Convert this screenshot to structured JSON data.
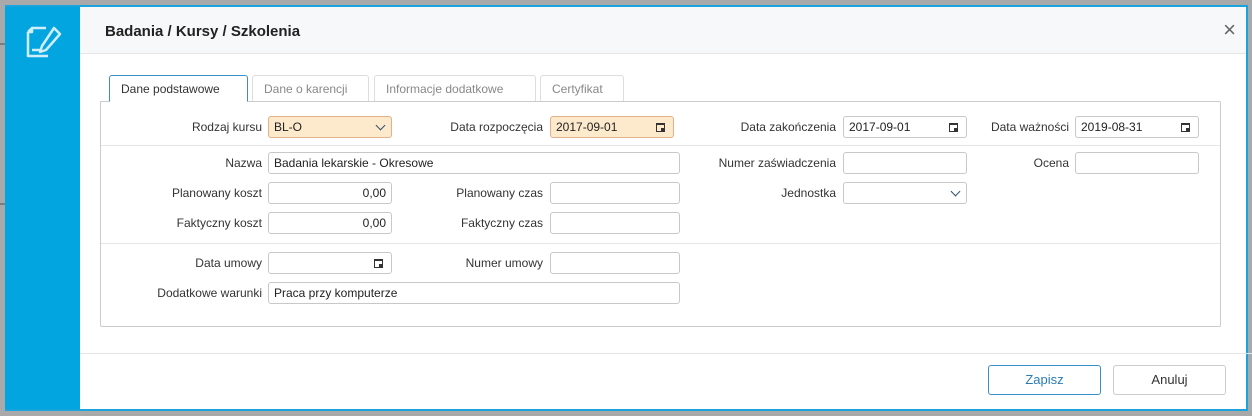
{
  "dialog": {
    "title": "Badania / Kursy / Szkolenia",
    "icon": "edit-document-icon",
    "close": "×"
  },
  "tabs": [
    {
      "label": "Dane podstawowe",
      "active": true
    },
    {
      "label": "Dane o karencji"
    },
    {
      "label": "Informacje dodatkowe"
    },
    {
      "label": "Certyfikat"
    }
  ],
  "form": {
    "rodzaj_kursu": {
      "label": "Rodzaj kursu",
      "value": "BL-O"
    },
    "data_rozpoczecia": {
      "label": "Data rozpoczęcia",
      "value": "2017-09-01"
    },
    "data_zakonczenia": {
      "label": "Data zakończenia",
      "value": "2017-09-01"
    },
    "data_waznosci": {
      "label": "Data ważności",
      "value": "2019-08-31"
    },
    "nazwa": {
      "label": "Nazwa",
      "value": "Badania lekarskie - Okresowe"
    },
    "numer_zaswiadczenia": {
      "label": "Numer zaświadczenia",
      "value": ""
    },
    "ocena": {
      "label": "Ocena",
      "value": ""
    },
    "planowany_koszt": {
      "label": "Planowany koszt",
      "value": "0,00"
    },
    "planowany_czas": {
      "label": "Planowany czas",
      "value": ""
    },
    "jednostka": {
      "label": "Jednostka",
      "value": ""
    },
    "faktyczny_koszt": {
      "label": "Faktyczny koszt",
      "value": "0,00"
    },
    "faktyczny_czas": {
      "label": "Faktyczny czas",
      "value": ""
    },
    "data_umowy": {
      "label": "Data umowy",
      "value": ""
    },
    "numer_umowy": {
      "label": "Numer umowy",
      "value": ""
    },
    "dodatkowe_warunki": {
      "label": "Dodatkowe warunki",
      "value": "Praca przy komputerze"
    }
  },
  "buttons": {
    "save": "Zapisz",
    "cancel": "Anuluj"
  },
  "colors": {
    "accent": "#03a5e0",
    "highlight": "#fde9cc"
  }
}
